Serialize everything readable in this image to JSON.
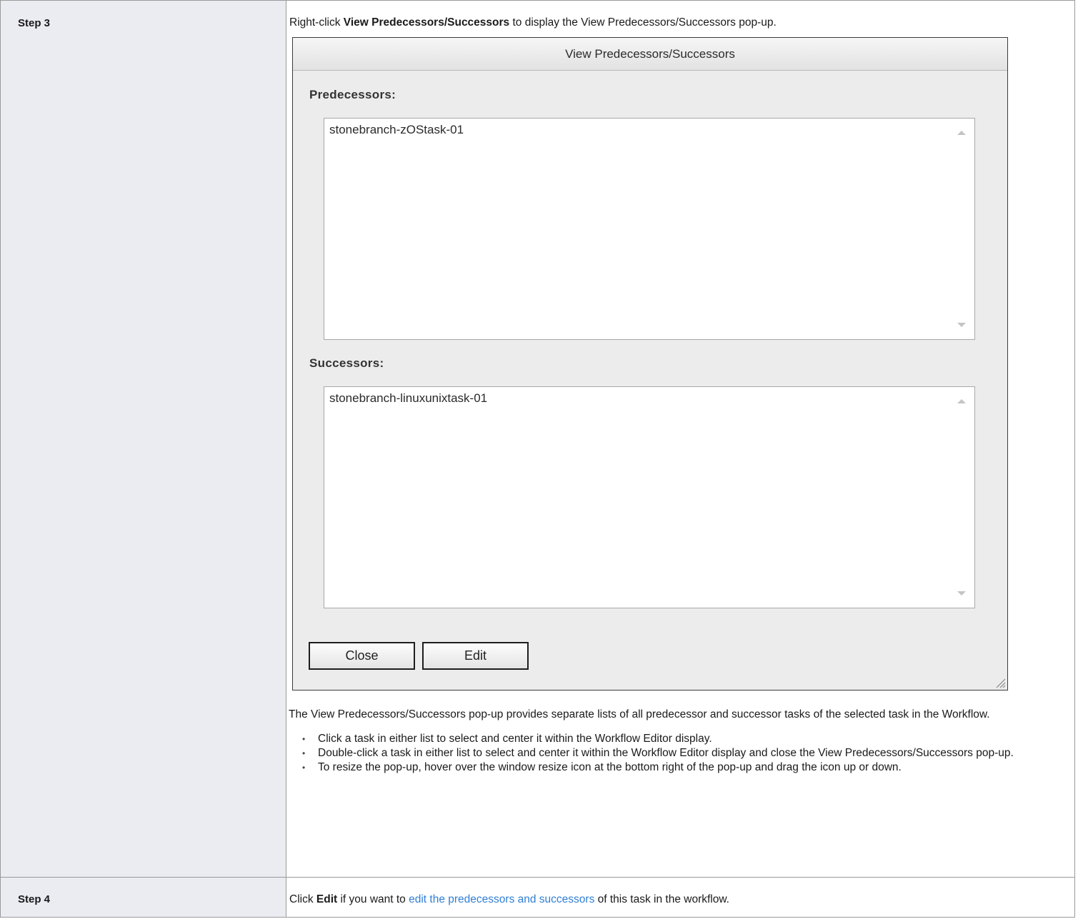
{
  "steps": [
    {
      "label": "Step 3",
      "intro": {
        "before": "Right-click ",
        "bold": "View Predecessors/Successors",
        "after": " to display the View Predecessors/Successors pop-up."
      },
      "dialog": {
        "title": "View Predecessors/Successors",
        "predecessors_label": "Predecessors:",
        "predecessors_items": [
          "stonebranch-zOStask-01"
        ],
        "successors_label": "Successors:",
        "successors_items": [
          "stonebranch-linuxunixtask-01"
        ],
        "close_label": "Close",
        "edit_label": "Edit"
      },
      "description": "The View Predecessors/Successors pop-up provides separate lists of all predecessor and successor tasks of the selected task in the Workflow.",
      "bullets": [
        "Click a task in either list to select and center it within the Workflow Editor display.",
        "Double-click a task in either list to select and center it within the Workflow Editor display and close the View Predecessors/Successors pop-up.",
        "To resize the pop-up, hover over the window resize icon at the bottom right of the pop-up and drag the icon up or down."
      ],
      "bullet_glyph": "•"
    },
    {
      "label": "Step 4",
      "text": {
        "before": "Click ",
        "bold": "Edit",
        "middle": " if you want to ",
        "link": "edit the predecessors and successors",
        "after": " of this task in the workflow."
      }
    }
  ],
  "colors": {
    "label_cell_bg": "#ebebf2",
    "link": "#2f7fd6",
    "dialog_bg": "#ececec"
  }
}
